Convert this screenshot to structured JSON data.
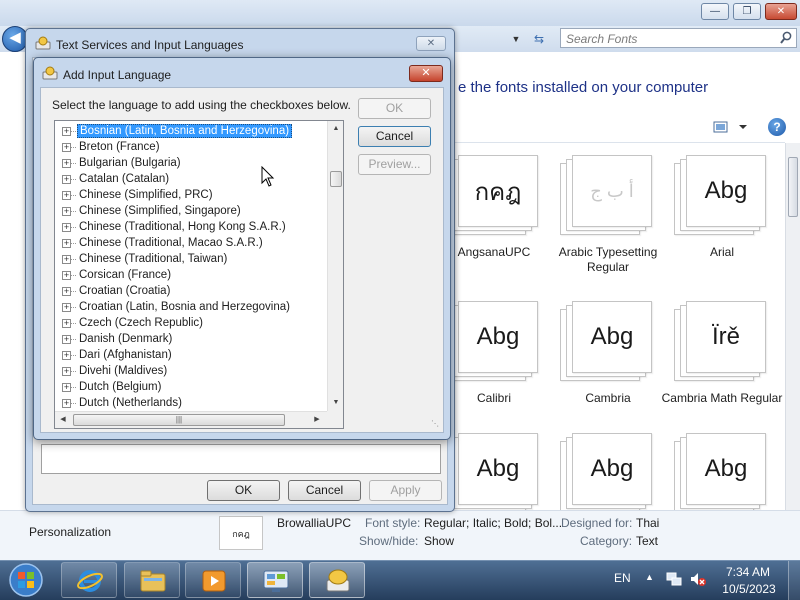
{
  "explorer": {
    "search_placeholder": "Search Fonts",
    "heading": "e the fonts installed on your computer",
    "fonts": [
      {
        "glyph": "กคฎ",
        "name": "AngsanaUPC"
      },
      {
        "glyph": "أ ب ج",
        "name": "Arabic Typesetting Regular"
      },
      {
        "glyph": "Abg",
        "name": "Arial"
      },
      {
        "glyph": "Abg",
        "name": "Calibri"
      },
      {
        "glyph": "Abg",
        "name": "Cambria"
      },
      {
        "glyph": "Ïrě",
        "name": "Cambria Math Regular"
      },
      {
        "glyph": "Abg",
        "name": ""
      },
      {
        "glyph": "Abg",
        "name": ""
      },
      {
        "glyph": "Abg",
        "name": ""
      }
    ],
    "details": {
      "sidebar_link": "Personalization",
      "thumb_glyph": "กคฎ",
      "font_name": "BrowalliaUPC",
      "font_style_label": "Font style:",
      "font_style_value": "Regular; Italic; Bold; Bol...",
      "show_hide_label": "Show/hide:",
      "show_hide_value": "Show",
      "designed_for_label": "Designed for:",
      "designed_for_value": "Thai",
      "category_label": "Category:",
      "category_value": "Text"
    }
  },
  "text_services": {
    "title": "Text Services and Input Languages",
    "ok_label": "OK",
    "cancel_label": "Cancel",
    "apply_label": "Apply"
  },
  "add_input_language": {
    "title": "Add Input Language",
    "instruction": "Select the language to add using the checkboxes below.",
    "ok_label": "OK",
    "cancel_label": "Cancel",
    "preview_label": "Preview...",
    "selected_index": 0,
    "languages": [
      "Bosnian (Latin, Bosnia and Herzegovina)",
      "Breton (France)",
      "Bulgarian (Bulgaria)",
      "Catalan (Catalan)",
      "Chinese (Simplified, PRC)",
      "Chinese (Simplified, Singapore)",
      "Chinese (Traditional, Hong Kong S.A.R.)",
      "Chinese (Traditional, Macao S.A.R.)",
      "Chinese (Traditional, Taiwan)",
      "Corsican (France)",
      "Croatian (Croatia)",
      "Croatian (Latin, Bosnia and Herzegovina)",
      "Czech (Czech Republic)",
      "Danish (Denmark)",
      "Dari (Afghanistan)",
      "Divehi (Maldives)",
      "Dutch (Belgium)",
      "Dutch (Netherlands)"
    ]
  },
  "taskbar": {
    "language": "EN",
    "time": "7:34 AM",
    "date": "10/5/2023"
  }
}
